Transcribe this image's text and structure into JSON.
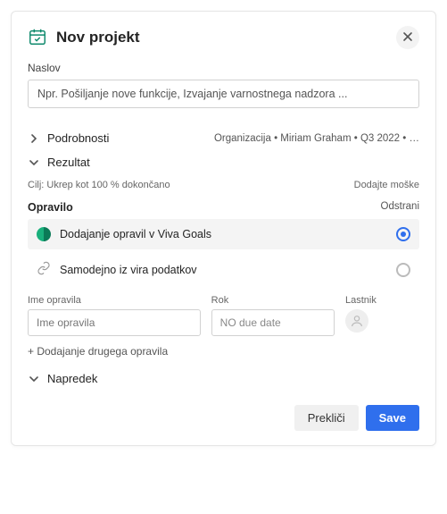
{
  "header": {
    "title": "Nov projekt"
  },
  "title_field": {
    "label": "Naslov",
    "placeholder": "Npr. Pošiljanje nove funkcije, Izvajanje varnostnega nadzora ..."
  },
  "details": {
    "label": "Podrobnosti",
    "meta": "Organizacija  •  Miriam Graham  •  Q3 2022  •  …"
  },
  "result": {
    "label": "Rezultat",
    "goal_text": "Cilj: Ukrep kot 100 % dokončano",
    "add_metric": "Dodajte moške"
  },
  "task": {
    "label": "Opravilo",
    "remove": "Odstrani",
    "options": [
      "Dodajanje opravil v Viva Goals",
      "Samodejno iz vira podatkov"
    ],
    "selected": 0,
    "fields": {
      "name_label": "Ime opravila",
      "name_placeholder": "Ime opravila",
      "due_label": "Rok",
      "due_placeholder": "NO due date",
      "owner_label": "Lastnik"
    },
    "add_another": "+ Dodajanje drugega opravila"
  },
  "progress": {
    "label": "Napredek"
  },
  "footer": {
    "cancel": "Prekliči",
    "save": "Save"
  }
}
